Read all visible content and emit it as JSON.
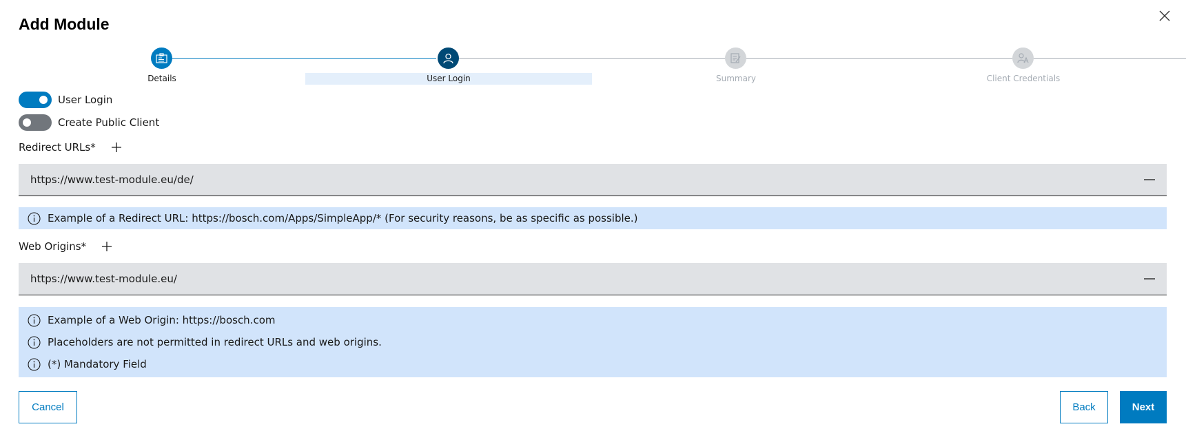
{
  "dialog": {
    "title": "Add Module"
  },
  "stepper": {
    "steps": [
      {
        "label": "Details",
        "state": "completed",
        "icon": "details-card-icon"
      },
      {
        "label": "User Login",
        "state": "active",
        "icon": "user-icon"
      },
      {
        "label": "Summary",
        "state": "inactive",
        "icon": "summary-edit-icon"
      },
      {
        "label": "Client Credentials",
        "state": "inactive",
        "icon": "client-credentials-icon"
      }
    ]
  },
  "toggles": {
    "user_login": {
      "label": "User Login",
      "on": true
    },
    "public_client": {
      "label": "Create Public Client",
      "on": false
    }
  },
  "redirect": {
    "label": "Redirect URLs*",
    "value": "https://www.test-module.eu/de/",
    "info": "Example of a Redirect URL: https://bosch.com/Apps/SimpleApp/* (For security reasons, be as specific as possible.)"
  },
  "origins": {
    "label": "Web Origins*",
    "value": "https://www.test-module.eu/",
    "info": [
      "Example of a Web Origin: https://bosch.com",
      "Placeholders are not permitted in redirect URLs and web origins.",
      "(*) Mandatory Field"
    ]
  },
  "buttons": {
    "cancel": "Cancel",
    "back": "Back",
    "next": "Next"
  },
  "colors": {
    "primary": "#007bc0",
    "active_step": "#004975",
    "inactive_step": "#d3d6d9",
    "info_bg": "#d1e4fb",
    "input_bg": "#e0e2e5",
    "toggle_off": "#71767c"
  }
}
